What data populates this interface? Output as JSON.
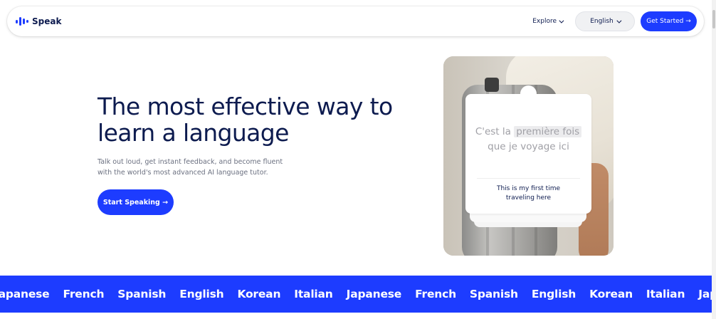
{
  "nav": {
    "brand_name": "Speak",
    "explore_label": "Explore",
    "language_label": "English",
    "cta_label": "Get Started →"
  },
  "hero": {
    "title_line1": "The most effective way to",
    "title_line2": "learn a language",
    "subtitle_line1": "Talk out loud, get instant feedback, and become fluent",
    "subtitle_line2": "with the world's most advanced AI language tutor.",
    "cta_label": "Start Speaking →"
  },
  "card": {
    "french_before": "C'est la ",
    "french_highlight": "première fois",
    "french_line2": "que je voyage ici",
    "english_line1": "This is my first time",
    "english_line2": "traveling here"
  },
  "marquee": {
    "languages": [
      "Japanese",
      "French",
      "Spanish",
      "English",
      "Korean",
      "Italian",
      "Japanese",
      "French",
      "Spanish",
      "English",
      "Korean",
      "Italian",
      "Japanese"
    ]
  },
  "colors": {
    "brand_blue": "#1d3cff",
    "navy_text": "#0d1b4f",
    "muted_text": "#6b7080"
  }
}
